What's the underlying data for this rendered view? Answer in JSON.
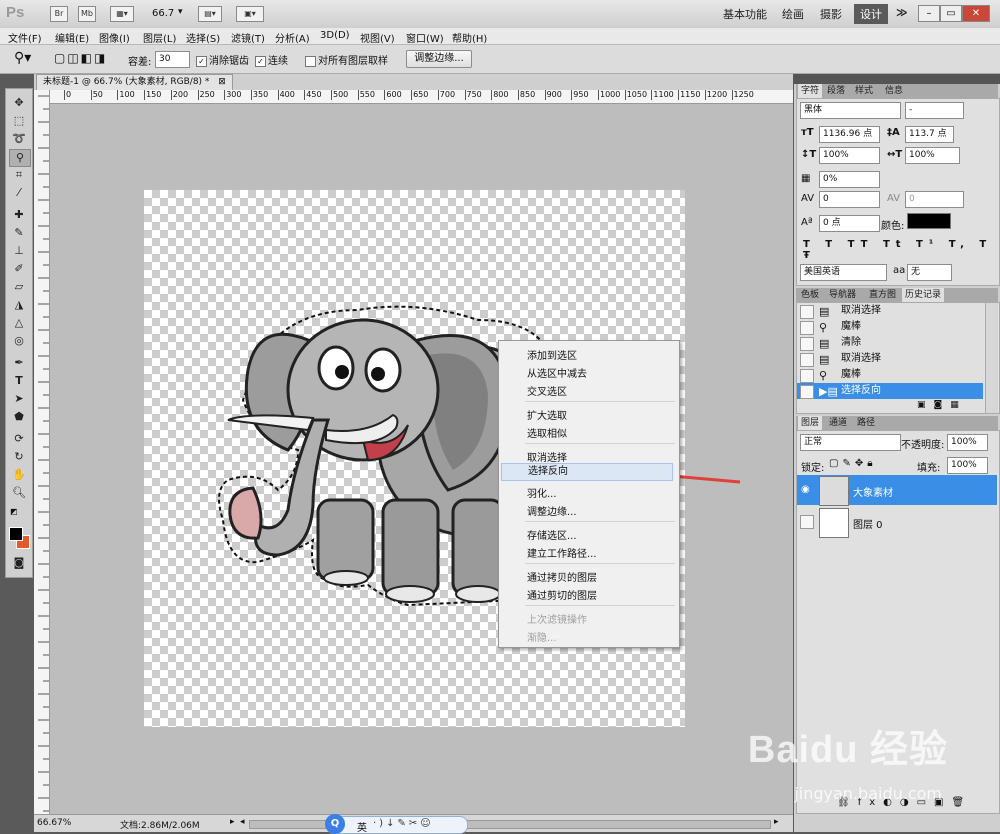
{
  "app": {
    "logo": "Ps",
    "br": "Br",
    "mb": "Mb",
    "zoom": "66.7",
    "workspaces": [
      "基本功能",
      "绘画",
      "摄影",
      "设计"
    ],
    "active_workspace": "设计",
    "more": "≫"
  },
  "menu": [
    "文件(F)",
    "编辑(E)",
    "图像(I)",
    "图层(L)",
    "选择(S)",
    "滤镜(T)",
    "分析(A)",
    "3D(D)",
    "视图(V)",
    "窗口(W)",
    "帮助(H)"
  ],
  "options": {
    "tolerance_label": "容差:",
    "tolerance_value": "30",
    "antialias": "消除锯齿",
    "contiguous": "连续",
    "sample_all": "对所有图层取样",
    "refine_button": "调整边缘..."
  },
  "document": {
    "tab_title": "未标题-1 @ 66.7% (大象素材, RGB/8) *",
    "ruler_ticks": [
      "0",
      "50",
      "100",
      "150",
      "200",
      "250",
      "300",
      "350",
      "400",
      "450",
      "500",
      "550",
      "600",
      "650",
      "700",
      "750",
      "800",
      "850",
      "900",
      "950",
      "1000",
      "1050",
      "1100",
      "1150",
      "1200",
      "1250"
    ],
    "status_zoom": "66.67%",
    "status_doc": "文档:2.86M/2.06M"
  },
  "context_menu": {
    "items": [
      {
        "label": "添加到选区",
        "enabled": true
      },
      {
        "label": "从选区中减去",
        "enabled": true
      },
      {
        "label": "交叉选区",
        "enabled": true
      },
      {
        "label": "扩大选取",
        "enabled": true
      },
      {
        "label": "选取相似",
        "enabled": true
      },
      {
        "label": "取消选择",
        "enabled": true
      },
      {
        "label": "选择反向",
        "enabled": true,
        "highlighted": true
      },
      {
        "label": "羽化...",
        "enabled": true
      },
      {
        "label": "调整边缘...",
        "enabled": true
      },
      {
        "label": "存储选区...",
        "enabled": true
      },
      {
        "label": "建立工作路径...",
        "enabled": true
      },
      {
        "label": "通过拷贝的图层",
        "enabled": true
      },
      {
        "label": "通过剪切的图层",
        "enabled": true
      },
      {
        "label": "上次滤镜操作",
        "enabled": false
      },
      {
        "label": "渐隐...",
        "enabled": false
      }
    ]
  },
  "character_panel": {
    "tabs": [
      "字符",
      "段落",
      "样式",
      "信息"
    ],
    "font_family": "黑体",
    "font_style": "-",
    "font_size": "1136.96 点",
    "leading": "113.7 点",
    "vertical_scale": "100%",
    "horizontal_scale": "100%",
    "tracking_ratio": "0%",
    "kerning": "0",
    "tracking": "0",
    "baseline_shift": "0 点",
    "color_label": "颜色:",
    "color": "#000000",
    "language": "美国英语",
    "antialias_label": "aa",
    "antialias": "无"
  },
  "history_panel": {
    "tabs": [
      "色板",
      "导航器",
      "直方图",
      "历史记录"
    ],
    "items": [
      {
        "label": "取消选择",
        "icon": "doc-icon"
      },
      {
        "label": "魔棒",
        "icon": "magic-wand-icon"
      },
      {
        "label": "清除",
        "icon": "doc-icon"
      },
      {
        "label": "取消选择",
        "icon": "doc-icon"
      },
      {
        "label": "魔棒",
        "icon": "magic-wand-icon"
      },
      {
        "label": "选择反向",
        "icon": "doc-icon",
        "selected": true
      }
    ]
  },
  "layers_panel": {
    "tabs": [
      "图层",
      "通道",
      "路径"
    ],
    "blend_mode": "正常",
    "opacity_label": "不透明度:",
    "opacity": "100%",
    "lock_label": "锁定:",
    "fill_label": "填充:",
    "fill": "100%",
    "layers": [
      {
        "name": "大象素材",
        "selected": true,
        "visible": true
      },
      {
        "name": "图层 0",
        "selected": false,
        "visible": false
      }
    ]
  },
  "taskbar": {
    "ime": "英"
  },
  "watermark": {
    "brand": "Baidu 经验",
    "url": "jingyan.baidu.com"
  },
  "colors": {
    "accent_selection": "#3a8ee6",
    "annotation_arrow": "#e0403a",
    "background_swatch": "#e05a2a"
  }
}
